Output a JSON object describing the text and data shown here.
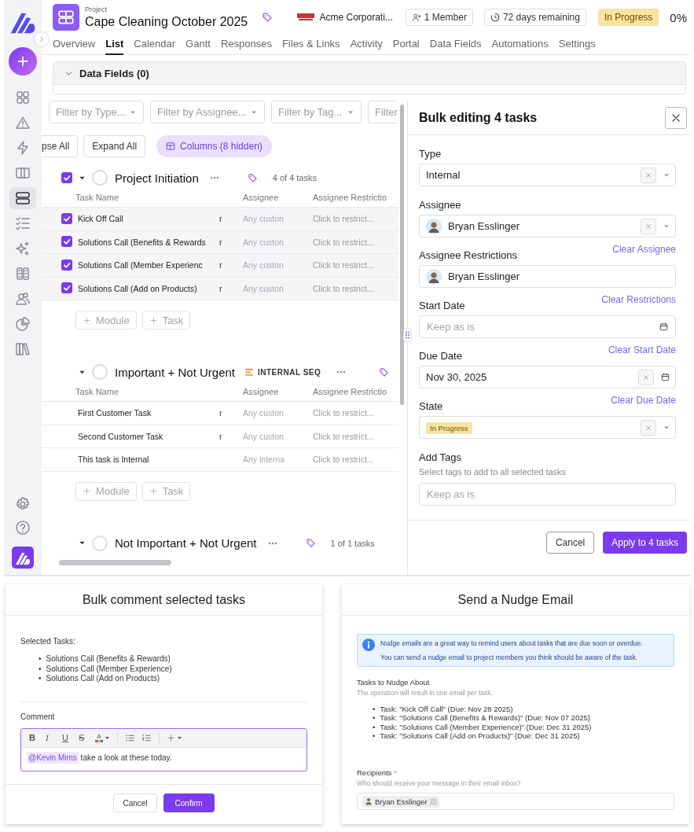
{
  "sidebar": {
    "items": [
      {
        "selected": false
      },
      {
        "selected": false
      },
      {
        "selected": false
      },
      {
        "selected": false
      },
      {
        "selected": true
      },
      {
        "selected": false
      },
      {
        "selected": false
      },
      {
        "selected": false
      },
      {
        "selected": false
      },
      {
        "selected": false
      },
      {
        "selected": false
      }
    ]
  },
  "project": {
    "label": "Project",
    "title": "Cape Cleaning October 2025",
    "client": "Acme Corporati...",
    "members": "1 Member",
    "remaining": "72 days remaining",
    "status": "In Progress",
    "progress": "0%"
  },
  "tabs": [
    {
      "label": "Overview",
      "selected": false
    },
    {
      "label": "List",
      "selected": true
    },
    {
      "label": "Calendar",
      "selected": false
    },
    {
      "label": "Gantt",
      "selected": false
    },
    {
      "label": "Responses",
      "selected": false
    },
    {
      "label": "Files & Links",
      "selected": false
    },
    {
      "label": "Activity",
      "selected": false
    },
    {
      "label": "Portal",
      "selected": false
    },
    {
      "label": "Data Fields",
      "selected": false
    },
    {
      "label": "Automations",
      "selected": false
    },
    {
      "label": "Settings",
      "selected": false
    }
  ],
  "data_fields": {
    "title": "Data Fields (0)"
  },
  "filters": [
    {
      "placeholder": "Filter by Type..."
    },
    {
      "placeholder": "Filter by Assignee..."
    },
    {
      "placeholder": "Filter by Tag..."
    },
    {
      "placeholder": "Filter"
    }
  ],
  "list_actions": {
    "collapse": "pse All",
    "expand": "Expand All",
    "columns": "Columns (8 hidden)"
  },
  "groups": [
    {
      "title": "Project Initiation",
      "checked": true,
      "count": "4 of 4 tasks",
      "columns": [
        "Task Name",
        "Assignee",
        "Assignee Restrictio"
      ],
      "rows": [
        {
          "checked": true,
          "name": "Kick Off Call",
          "column_2": "r",
          "assignee": "Any custon",
          "restriction": "Click to restrict..."
        },
        {
          "checked": true,
          "name": "Solutions Call (Benefits & Rewards",
          "column_2": "r",
          "assignee": "Any custon",
          "restriction": "Click to restrict..."
        },
        {
          "checked": true,
          "name": "Solutions Call (Member Experienc",
          "column_2": "r",
          "assignee": "Any custon",
          "restriction": "Click to restrict..."
        },
        {
          "checked": true,
          "name": "Solutions Call (Add on Products)",
          "column_2": "r",
          "assignee": "Any custon",
          "restriction": "Click to restrict..."
        }
      ],
      "add_buttons": [
        "Module",
        "Task"
      ]
    },
    {
      "title": "Important + Not Urgent",
      "checked": false,
      "sequence": "INTERNAL SEQ",
      "columns": [
        "Task Name",
        "Assignee",
        "Assignee Restrictio"
      ],
      "rows": [
        {
          "checked": false,
          "name": "First Customer Task",
          "column_2": "r",
          "assignee": "Any custon",
          "restriction": "Click to restrict..."
        },
        {
          "checked": false,
          "name": "Second Customer Task",
          "column_2": "r",
          "assignee": "Any custon",
          "restriction": "Click to restrict..."
        },
        {
          "checked": false,
          "name": "This task is Internal",
          "assignee": "Any interna",
          "restriction": "Click to restrict..."
        }
      ],
      "add_buttons": [
        "Module",
        "Task"
      ]
    },
    {
      "title": "Not Important + Not Urgent",
      "checked": false,
      "count": "1 of 1 tasks"
    }
  ],
  "bulk_edit": {
    "title": "Bulk editing 4 tasks",
    "fields": [
      {
        "kind": "select",
        "label": "Type",
        "value": "Internal",
        "clearable": true
      },
      {
        "kind": "person-select",
        "label": "Assignee",
        "value": "Bryan Esslinger",
        "clearable": true,
        "link": "Clear Assignee"
      },
      {
        "kind": "person",
        "label": "Assignee Restrictions",
        "value": "Bryan Esslinger",
        "clearable": false,
        "link": "Clear Restrictions"
      },
      {
        "kind": "date",
        "label": "Start Date",
        "placeholder": "Keep as is",
        "link": "Clear Start Date"
      },
      {
        "kind": "date",
        "label": "Due Date",
        "value": "Nov 30, 2025",
        "clearable": true,
        "link": "Clear Due Date"
      },
      {
        "kind": "status",
        "label": "State",
        "value": "In Progress",
        "clearable": true
      },
      {
        "kind": "tags",
        "label": "Add Tags",
        "hint": "Select tags to add to all selected tasks",
        "placeholder": "Keep as is"
      }
    ],
    "buttons": [
      {
        "kind": "secondary",
        "label": "Cancel"
      },
      {
        "kind": "primary",
        "label": "Apply to 4 tasks"
      }
    ]
  },
  "comment_dialog": {
    "title": "Bulk comment selected tasks",
    "selected_label": "Selected Tasks:",
    "bullet": "•",
    "tasks": [
      "Solutions Call (Benefits & Rewards)",
      "Solutions Call (Member Experience)",
      "Solutions Call (Add on Products)"
    ],
    "comment_label": "Comment",
    "toolbar": [
      {
        "kind": "bold",
        "label": "B"
      },
      {
        "kind": "italic",
        "label": "I"
      },
      {
        "kind": "underline",
        "label": "U"
      },
      {
        "kind": "strike",
        "label": "S"
      },
      {
        "kind": "color",
        "label": "A"
      },
      {
        "kind": "bullets"
      },
      {
        "kind": "numbers"
      },
      {
        "kind": "insert"
      }
    ],
    "mention": "@Kevin Mims",
    "text": "take a look at these today.",
    "buttons": [
      {
        "kind": "secondary",
        "label": "Cancel"
      },
      {
        "kind": "primary",
        "label": "Confirm"
      }
    ]
  },
  "nudge_dialog": {
    "title": "Send a Nudge Email",
    "info": [
      "Nudge emails are a great way to remind users about tasks that are due soon or overdue.",
      "You can send a nudge email to project members you think should be aware of the task."
    ],
    "tasks_label": "Tasks to Nudge About",
    "bullet": "•",
    "tasks_hint": "The operation will result in one email per task.",
    "tasks": [
      "Task: \"Kick Off Call\" (Due: Nov 28 2025)",
      "Task: \"Solutions Call (Benefits & Rewards)\" (Due: Nov 07 2025)",
      "Task: \"Solutions Call (Member Experience)\" (Due: Dec 31 2025)",
      "Task: \"Solutions Call (Add on Products)\" (Due: Dec 31 2025)"
    ],
    "recipients_label": "Recipients",
    "required": "*",
    "recipients_hint": "Who should receive your message in their email inbox?",
    "recipients": [
      "Bryan Esslinger"
    ]
  }
}
